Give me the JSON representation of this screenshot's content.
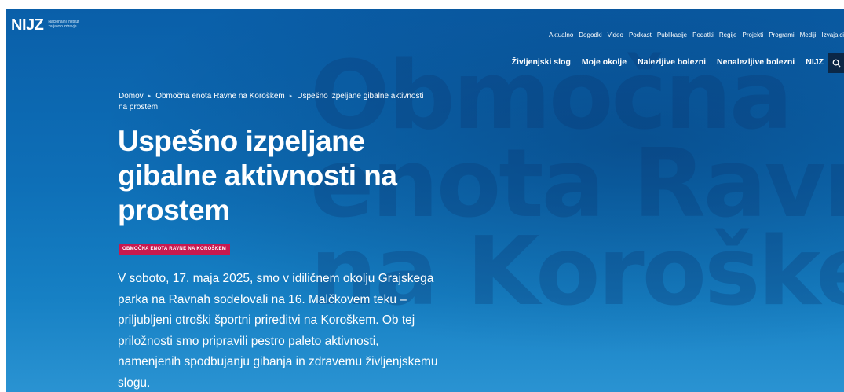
{
  "watermark": {
    "line1": "Območna",
    "line2": "enota Ravne",
    "line3": "na Koroškem"
  },
  "logo": {
    "mark": "NIJZ",
    "line1": "Nacionalni inštitut",
    "line2": "za javno zdravje"
  },
  "nav_top": [
    "Aktualno",
    "Dogodki",
    "Video",
    "Podkast",
    "Publikacije",
    "Podatki",
    "Regije",
    "Projekti",
    "Programi",
    "Mediji",
    "Izvajalci"
  ],
  "nav_main": [
    "Življenjski slog",
    "Moje okolje",
    "Nalezljive bolezni",
    "Nenalezljive bolezni",
    "NIJZ"
  ],
  "search": {
    "icon": "search-icon"
  },
  "breadcrumb": {
    "home": "Domov",
    "section": "Območna enota Ravne na Koroškem",
    "current": "Uspešno izpeljane gibalne aktivnosti na prostem"
  },
  "article": {
    "title": "Uspešno izpeljane gibalne aktivnosti na prostem",
    "category": "OBMOČNA ENOTA RAVNE NA KOROŠKEM",
    "lead": "V soboto, 17. maja 2025, smo v idiličnem okolju Grajskega parka na Ravnah sodelovali na 16. Malčkovem teku – priljubljeni otroški športni prireditvi na Koroškem. Ob tej priložnosti smo pripravili pestro paleto aktivnosti, namenjenih spodbujanju gibanja in zdravemu življenjskemu slogu."
  },
  "colors": {
    "hero_blue": "#0e6fb7",
    "badge": "#c8194f",
    "search_bg": "#0b2746",
    "text": "#ffffff"
  }
}
